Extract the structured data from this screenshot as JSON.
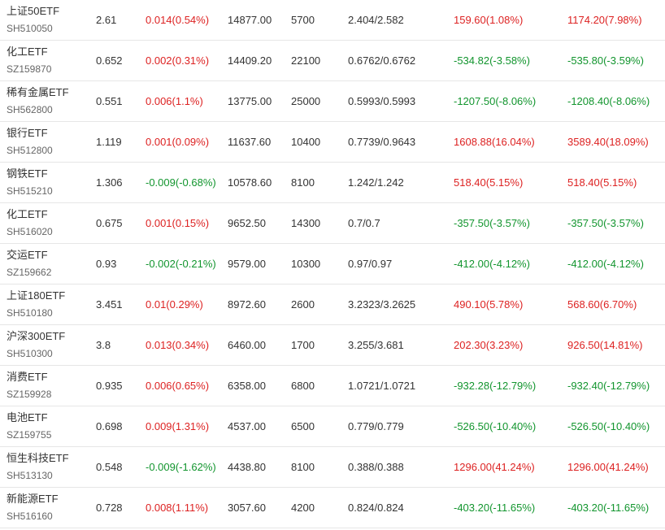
{
  "colors": {
    "up": "#dd2222",
    "down": "#12952e",
    "text": "#333333",
    "subtext": "#666666",
    "divider": "#e6e6e6"
  },
  "rows": [
    {
      "name": "上证50ETF",
      "code": "SH510050",
      "price": "2.61",
      "change": "0.014(0.54%)",
      "change_dir": "up",
      "amount": "14877.00",
      "volume": "5700",
      "cost": "2.404/2.582",
      "pnl1": "159.60(1.08%)",
      "pnl1_dir": "up",
      "pnl2": "1174.20(7.98%)",
      "pnl2_dir": "up"
    },
    {
      "name": "化工ETF",
      "code": "SZ159870",
      "price": "0.652",
      "change": "0.002(0.31%)",
      "change_dir": "up",
      "amount": "14409.20",
      "volume": "22100",
      "cost": "0.6762/0.6762",
      "pnl1": "-534.82(-3.58%)",
      "pnl1_dir": "down",
      "pnl2": "-535.80(-3.59%)",
      "pnl2_dir": "down"
    },
    {
      "name": "稀有金属ETF",
      "code": "SH562800",
      "price": "0.551",
      "change": "0.006(1.1%)",
      "change_dir": "up",
      "amount": "13775.00",
      "volume": "25000",
      "cost": "0.5993/0.5993",
      "pnl1": "-1207.50(-8.06%)",
      "pnl1_dir": "down",
      "pnl2": "-1208.40(-8.06%)",
      "pnl2_dir": "down"
    },
    {
      "name": "银行ETF",
      "code": "SH512800",
      "price": "1.119",
      "change": "0.001(0.09%)",
      "change_dir": "up",
      "amount": "11637.60",
      "volume": "10400",
      "cost": "0.7739/0.9643",
      "pnl1": "1608.88(16.04%)",
      "pnl1_dir": "up",
      "pnl2": "3589.40(18.09%)",
      "pnl2_dir": "up"
    },
    {
      "name": "钢铁ETF",
      "code": "SH515210",
      "price": "1.306",
      "change": "-0.009(-0.68%)",
      "change_dir": "down",
      "amount": "10578.60",
      "volume": "8100",
      "cost": "1.242/1.242",
      "pnl1": "518.40(5.15%)",
      "pnl1_dir": "up",
      "pnl2": "518.40(5.15%)",
      "pnl2_dir": "up"
    },
    {
      "name": "化工ETF",
      "code": "SH516020",
      "price": "0.675",
      "change": "0.001(0.15%)",
      "change_dir": "up",
      "amount": "9652.50",
      "volume": "14300",
      "cost": "0.7/0.7",
      "pnl1": "-357.50(-3.57%)",
      "pnl1_dir": "down",
      "pnl2": "-357.50(-3.57%)",
      "pnl2_dir": "down"
    },
    {
      "name": "交运ETF",
      "code": "SZ159662",
      "price": "0.93",
      "change": "-0.002(-0.21%)",
      "change_dir": "down",
      "amount": "9579.00",
      "volume": "10300",
      "cost": "0.97/0.97",
      "pnl1": "-412.00(-4.12%)",
      "pnl1_dir": "down",
      "pnl2": "-412.00(-4.12%)",
      "pnl2_dir": "down"
    },
    {
      "name": "上证180ETF",
      "code": "SH510180",
      "price": "3.451",
      "change": "0.01(0.29%)",
      "change_dir": "up",
      "amount": "8972.60",
      "volume": "2600",
      "cost": "3.2323/3.2625",
      "pnl1": "490.10(5.78%)",
      "pnl1_dir": "up",
      "pnl2": "568.60(6.70%)",
      "pnl2_dir": "up"
    },
    {
      "name": "沪深300ETF",
      "code": "SH510300",
      "price": "3.8",
      "change": "0.013(0.34%)",
      "change_dir": "up",
      "amount": "6460.00",
      "volume": "1700",
      "cost": "3.255/3.681",
      "pnl1": "202.30(3.23%)",
      "pnl1_dir": "up",
      "pnl2": "926.50(14.81%)",
      "pnl2_dir": "up"
    },
    {
      "name": "消费ETF",
      "code": "SZ159928",
      "price": "0.935",
      "change": "0.006(0.65%)",
      "change_dir": "up",
      "amount": "6358.00",
      "volume": "6800",
      "cost": "1.0721/1.0721",
      "pnl1": "-932.28(-12.79%)",
      "pnl1_dir": "down",
      "pnl2": "-932.40(-12.79%)",
      "pnl2_dir": "down"
    },
    {
      "name": "电池ETF",
      "code": "SZ159755",
      "price": "0.698",
      "change": "0.009(1.31%)",
      "change_dir": "up",
      "amount": "4537.00",
      "volume": "6500",
      "cost": "0.779/0.779",
      "pnl1": "-526.50(-10.40%)",
      "pnl1_dir": "down",
      "pnl2": "-526.50(-10.40%)",
      "pnl2_dir": "down"
    },
    {
      "name": "恒生科技ETF",
      "code": "SH513130",
      "price": "0.548",
      "change": "-0.009(-1.62%)",
      "change_dir": "down",
      "amount": "4438.80",
      "volume": "8100",
      "cost": "0.388/0.388",
      "pnl1": "1296.00(41.24%)",
      "pnl1_dir": "up",
      "pnl2": "1296.00(41.24%)",
      "pnl2_dir": "up"
    },
    {
      "name": "新能源ETF",
      "code": "SH516160",
      "price": "0.728",
      "change": "0.008(1.11%)",
      "change_dir": "up",
      "amount": "3057.60",
      "volume": "4200",
      "cost": "0.824/0.824",
      "pnl1": "-403.20(-11.65%)",
      "pnl1_dir": "down",
      "pnl2": "-403.20(-11.65%)",
      "pnl2_dir": "down"
    }
  ]
}
